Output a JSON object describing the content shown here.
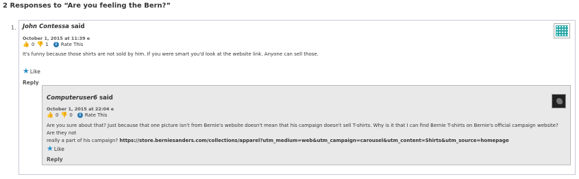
{
  "heading": "2 Responses to “Are you feeling the Bern?”",
  "list_number": "1.",
  "comment1": {
    "author": "John Contessa",
    "said": " said",
    "date": "October 1, 2015 at 11:39 e",
    "likes": "0",
    "dislikes": "1",
    "rate_label": "Rate This",
    "text": "It's funny because those shirts are not sold by him. If you were smart you'd look at the website link. Anyone can sell those.",
    "like_label": "Like",
    "reply_label": "Reply"
  },
  "comment2": {
    "author": "Computeruser6",
    "said": " said",
    "date": "October 1, 2015 at 22:04 e",
    "likes": "0",
    "dislikes": "0",
    "rate_label": "Rate This",
    "text_line1": "Are you sure about that? Just because that one picture isn't from Bernie's website doesn't mean that his campaign doesn't sell T-shirts. Why is it that I can find Bernie T-shirts on Bernie's official campaign website? Are they not",
    "text_line2_prefix": "really a part of his campaign? ",
    "link": "https://store.berniesanders.com/collections/apparel?utm_medium=web&utm_campaign=carousel&utm_content=Shirts&utm_source=homepage",
    "like_label": "Like",
    "reply_label": "Reply"
  },
  "colors": {
    "like_star": "#2a90c8",
    "thumb_up": "#d9a441",
    "thumb_down": "#d0553a",
    "info": "#2a7ab0",
    "reply_bg": "#e9e9ea"
  },
  "icons": {
    "thumb_up": "thumbs-up-icon",
    "thumb_down": "thumbs-down-icon",
    "info": "info-icon",
    "like": "star-icon"
  }
}
